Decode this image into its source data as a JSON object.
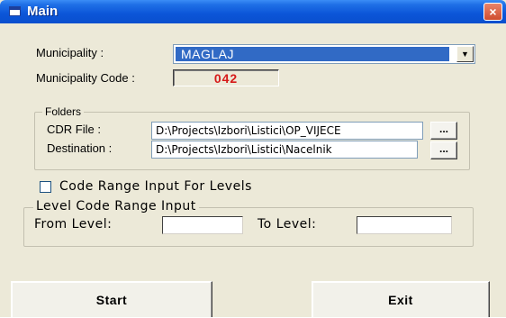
{
  "window": {
    "title": "Main",
    "close_glyph": "×"
  },
  "municipality": {
    "label": "Municipality :",
    "selected": "MAGLAJ"
  },
  "municipality_code": {
    "label": "Municipality Code :",
    "value": "042"
  },
  "folders": {
    "title": "Folders",
    "cdr_label": "CDR File :",
    "cdr_value": "D:\\Projects\\Izbori\\Listici\\OP_VIJECE",
    "destination_label": "Destination :",
    "destination_value": "D:\\Projects\\Izbori\\Listici\\Nacelnik",
    "browse_label": "..."
  },
  "code_range": {
    "checkbox_label": "Code Range Input For Levels",
    "checked": false,
    "group_title": "Level Code Range Input",
    "from_label": "From Level:",
    "from_value": "",
    "to_label": "To Level:",
    "to_value": ""
  },
  "actions": {
    "start_label": "Start",
    "exit_label": "Exit"
  },
  "colors": {
    "titlebar": "#0b55d8",
    "selection": "#316ac5",
    "code_text": "#d61a1a",
    "close_button": "#cf4c2e"
  }
}
